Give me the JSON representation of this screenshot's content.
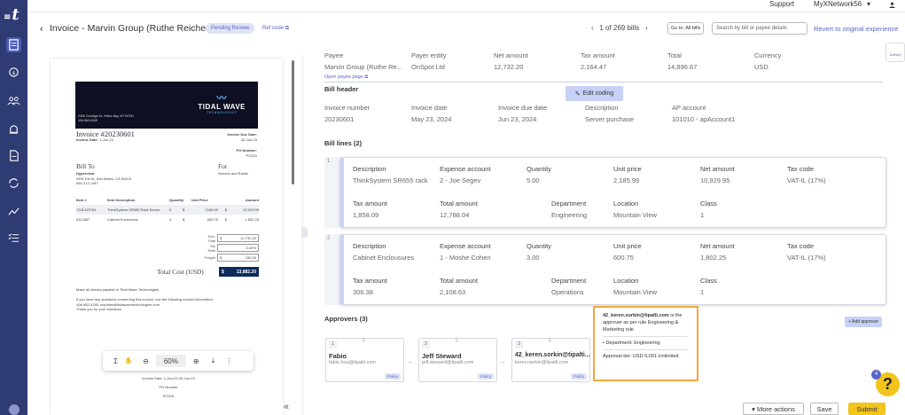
{
  "topbar": {
    "support": "Support",
    "account": "MyXNetwork56",
    "account_chevron": "▾",
    "user_icon": "user-icon"
  },
  "header": {
    "back": "‹",
    "title": "Invoice - Marvin Group (Ruthe Reichert)",
    "status": "Pending Review",
    "refcode": "Ref code",
    "pager_prev": "‹",
    "pager": "1 of 269 bills",
    "pager_next": "›",
    "goto": "Go to: All bills",
    "search_placeholder": "Search by bill or payee details",
    "revert": "Revert to original experience"
  },
  "sidebar": {
    "items": [
      "bills-icon",
      "payments-icon",
      "suppliers-icon",
      "approvals-icon",
      "documents-icon",
      "sync-icon",
      "reports-icon",
      "tasks-icon"
    ]
  },
  "document": {
    "address": "2356 Coolidge St, Yellow Bay, MT 59761",
    "phone": "406-860-6165",
    "brand_top": "TIDAL WAVE",
    "brand_sub": "TECHNOLOGIES",
    "invoice_no": "Invoice #20230601",
    "invoice_date_label": "Invoice Date:",
    "invoice_date": "1-Jun-23",
    "due_label": "Invoice Due Date:",
    "due": "30-Jun-23",
    "po_label": "PO Number:",
    "po": "PO310",
    "bill_to": "Bill To",
    "for": "For",
    "customer": "Hyperclear",
    "customer_addr": "2692 Elk St, San Mateo, CA 94403",
    "customer_phone": "650-212-1187",
    "for_text": "Servers and Racks",
    "columns": [
      "Item #",
      "Item Description",
      "Quantity",
      "Unit Price",
      "Amount"
    ],
    "rows": [
      [
        "7231415764",
        "ThinkSystem SR655 Rack Server",
        "5",
        "$",
        "2185.99",
        "$",
        "10,929.95"
      ],
      [
        "5112867",
        "Cabinet Enclosures",
        "3",
        "$",
        "600.75",
        "$",
        "1,802.25"
      ]
    ],
    "totals": [
      {
        "label": "Sub-Total",
        "cur": "$",
        "value": "12,732.20"
      },
      {
        "label": "Tax Rate",
        "cur": "",
        "value": "0.00%"
      },
      {
        "label": "Freight",
        "cur": "$",
        "value": "150.00"
      }
    ],
    "total_cost_label": "Total Cost (USD)",
    "total_cost_cur": "$",
    "total_cost": "13,882.20",
    "notes": [
      "Make all checks payable to Tidal Wave Technologies",
      "If you have any questions concerning this invoice, use the following contact information:",
      "406-982-4185, inquiries@tidalwavetechnologies.com",
      "Thank you for your business!"
    ],
    "footer_invoice_date": "Invoice Date: 1-Jun-23 30-Jun-23",
    "footer_po_label": "PO Number",
    "footer_po": "PO310"
  },
  "viewer_toolbar": {
    "cursor": "Ɪ",
    "hand": "✋",
    "zoom_out": "⊖",
    "zoom": "60%",
    "zoom_in": "⊕",
    "download": "⤓",
    "more": "⋮",
    "collapse": "«"
  },
  "summary": {
    "labels": [
      "Payee",
      "Payer entity",
      "Net amount",
      "Tax amount",
      "Total",
      "Currency"
    ],
    "values": [
      "Marvin Group (Ruthe Re...",
      "OnSpot Ltd",
      "12,732.20",
      "2,164.47",
      "14,896.67",
      "USD"
    ],
    "open_payee": "Open payee page"
  },
  "bill_header": {
    "title": "Bill header",
    "edit_coding": "Edit coding",
    "labels": [
      "Invoice number",
      "Invoice date",
      "Invoice due date",
      "Description",
      "AP account"
    ],
    "values": [
      "20230601",
      "May 23, 2024",
      "Jun 23, 2024",
      "Server purchase",
      "101010 - apAccount1"
    ]
  },
  "bill_lines": {
    "title": "Bill lines (2)",
    "label_row1": [
      "Description",
      "Expense account",
      "Quantity",
      "Unit price",
      "Net amount",
      "Tax code"
    ],
    "label_row2": [
      "Tax amount",
      "Total amount",
      "Department",
      "Location",
      "Class"
    ],
    "lines": [
      {
        "num": "1",
        "row1": [
          "ThinkSystem SR655 rack",
          "2 - Joe Segev",
          "5.00",
          "2,185.99",
          "10,929.95",
          "VAT-IL (17%)"
        ],
        "row2": [
          "1,858.09",
          "12,788.04",
          "Engineering",
          "Mountain View",
          "1"
        ]
      },
      {
        "num": "2",
        "row1": [
          "Cabinet Enclousures",
          "1 - Moshe Cohen",
          "3.00",
          "600.75",
          "1,802.25",
          "VAT-IL (17%)"
        ],
        "row2": [
          "306.38",
          "2,108.63",
          "Operations",
          "Mountain View",
          "1"
        ]
      }
    ]
  },
  "approvers": {
    "title": "Approvers (3)",
    "add": "+ Add approver",
    "list": [
      {
        "num": "1",
        "name": "Fabio",
        "email": "fabio.hou@tipalti.com",
        "policy": "Policy"
      },
      {
        "num": "2",
        "name": "Jeff Steward",
        "email": "jeff.steward@tipalti.com",
        "policy": "Policy"
      },
      {
        "num": "3",
        "name": "42_keren.sorkin@tipalti...",
        "email": "keren.sorkin@tipalti.com",
        "policy": "Policy"
      }
    ],
    "tooltip": {
      "email": "42_keren.sorkin@tipalti.com",
      "rest": " is the approver as per rule Engineering & Marketing rule",
      "dept": "• Department: Engineering",
      "tier": "Approval tier: USD 6,001-Unlimited"
    }
  },
  "activity": "Activity",
  "help": {
    "badge": "4",
    "label": "?"
  },
  "actions": {
    "more": "▾ More actions",
    "save": "Save",
    "submit": "Submit"
  }
}
